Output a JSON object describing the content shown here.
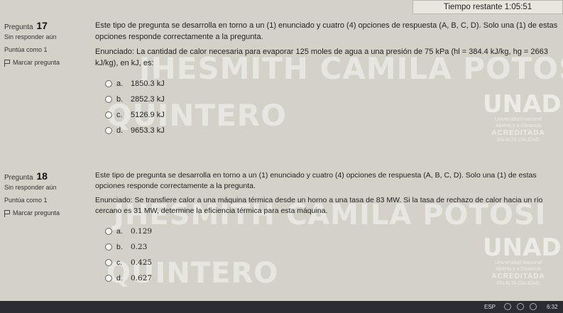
{
  "timer": {
    "label": "Tiempo restante",
    "value": "1:05:51"
  },
  "questions": [
    {
      "title_prefix": "Pregunta",
      "number": "17",
      "status": "Sin responder aún",
      "score": "Puntúa como 1",
      "flag_label": "Marcar pregunta",
      "instructions": "Este tipo de pregunta se desarrolla en torno a un (1) enunciado y cuatro (4) opciones de respuesta (A, B, C, D). Solo una (1) de estas opciones responde correctamente a la pregunta.",
      "statement": "Enunciado: La cantidad de calor necesaria para evaporar 125 moles de agua a una presión de 75 kPa (hl = 384.4 kJ/kg, hg = 2663 kJ/kg), en kJ, es:",
      "options": [
        {
          "letter": "a.",
          "text": "1850.3 kJ"
        },
        {
          "letter": "b.",
          "text": "2852.3 kJ"
        },
        {
          "letter": "c.",
          "text": "5126.9 kJ"
        },
        {
          "letter": "d.",
          "text": "9653.3 kJ"
        }
      ]
    },
    {
      "title_prefix": "Pregunta",
      "number": "18",
      "status": "Sin responder aún",
      "score": "Puntúa como 1",
      "flag_label": "Marcar pregunta",
      "instructions": "Este tipo de pregunta se desarrolla en torno a un (1) enunciado y cuatro (4) opciones de respuesta (A, B, C, D). Solo una (1) de estas opciones responde correctamente a la pregunta.",
      "statement": "Enunciado: Se transfiere calor a una máquina térmica desde un horno a una tasa de 83 MW. Si la tasa de rechazo de calor hacia un río cercano es 31 MW, determine la eficiencia térmica para esta máquina.",
      "options": [
        {
          "letter": "a.",
          "text": "0.129"
        },
        {
          "letter": "b.",
          "text": "0.23"
        },
        {
          "letter": "c.",
          "text": "0.425"
        },
        {
          "letter": "d.",
          "text": "0.627"
        }
      ]
    }
  ],
  "watermark": {
    "name_line1": "JHESMITH CAMILA POTOSI",
    "name_line2": "QUINTERO",
    "logo": "UNAD",
    "logo_sub1": "Universidad Nacional",
    "logo_sub2": "Abierta y a Distancia",
    "logo_acc": "ACREDITADA",
    "logo_acc_sub": "EN ALTA CALIDAD"
  },
  "taskbar": {
    "lang": "ESP",
    "time": "6:32"
  }
}
